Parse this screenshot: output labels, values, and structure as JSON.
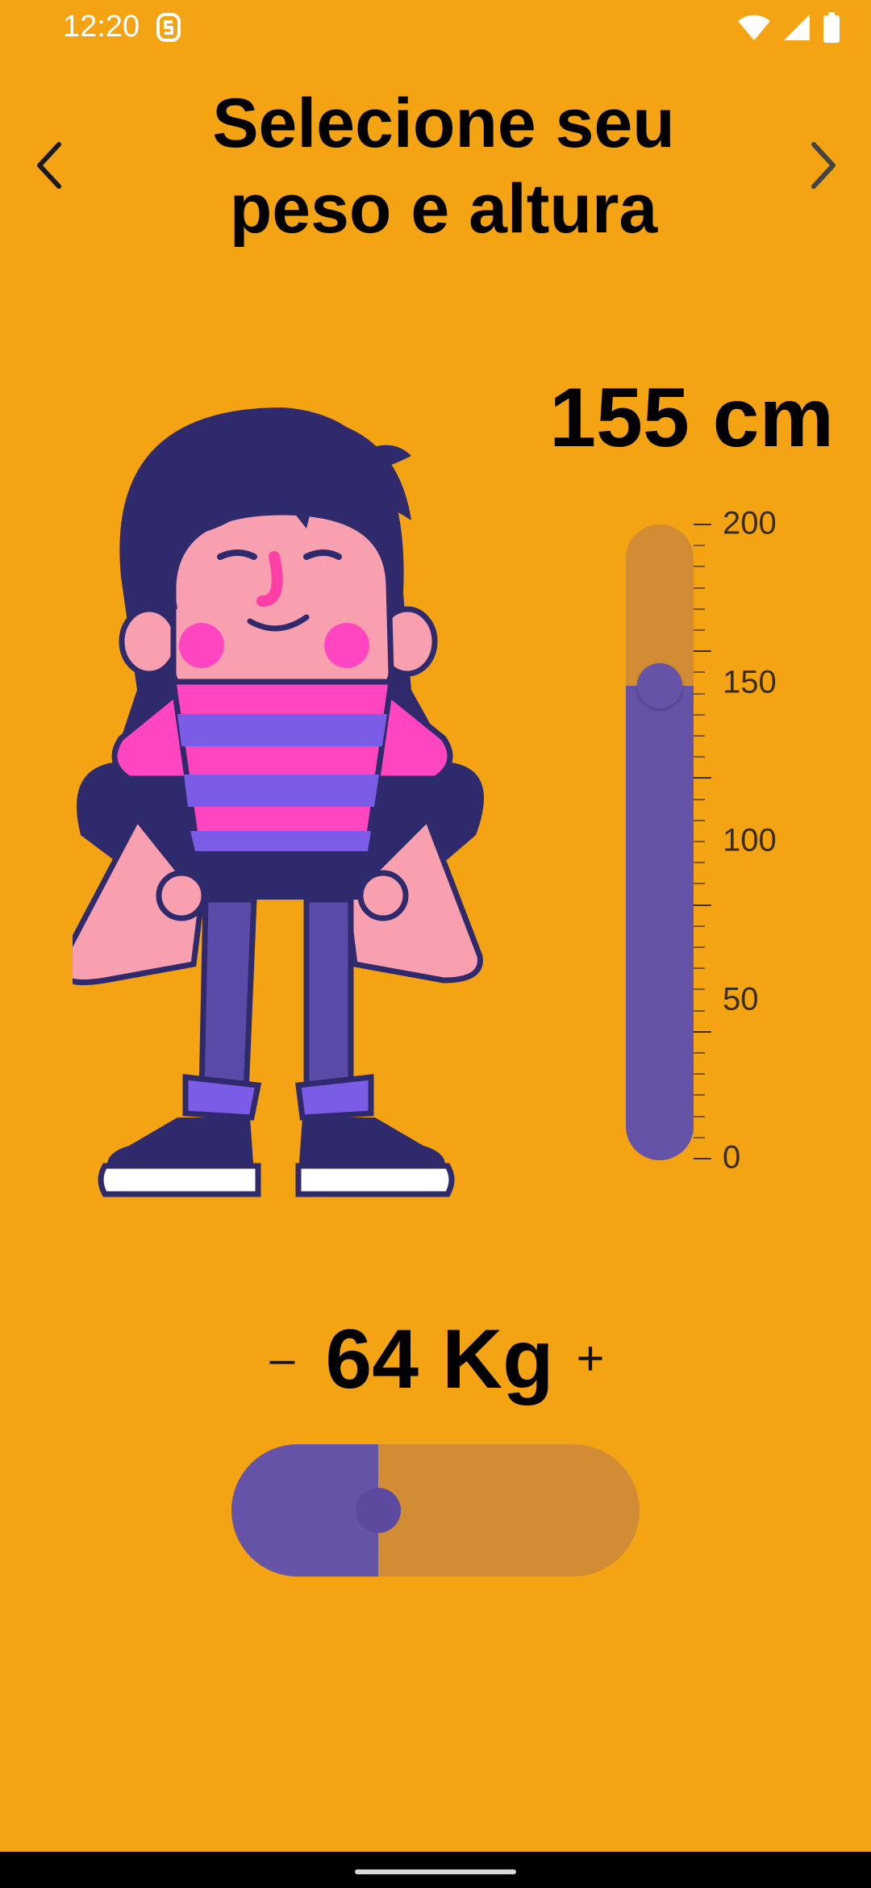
{
  "status_bar": {
    "time": "12:20",
    "icons": [
      "app-s-icon",
      "wifi-icon",
      "signal-icon",
      "battery-icon"
    ]
  },
  "header": {
    "title": "Selecione seu peso e altura",
    "back_icon": "chevron-left-icon",
    "forward_icon": "chevron-right-icon"
  },
  "height": {
    "display": "155 cm",
    "value": 155,
    "min": 0,
    "max": 200,
    "scale_labels": [
      "200",
      "150",
      "100",
      "50",
      "0"
    ]
  },
  "weight": {
    "display": "64 Kg",
    "value": 64,
    "minus_label": "–",
    "plus_label": "+",
    "fill_fraction": 0.36
  },
  "colors": {
    "background": "#F4A413",
    "slider_track": "#D28C34",
    "slider_fill": "#6553A8",
    "text": "#000000"
  }
}
